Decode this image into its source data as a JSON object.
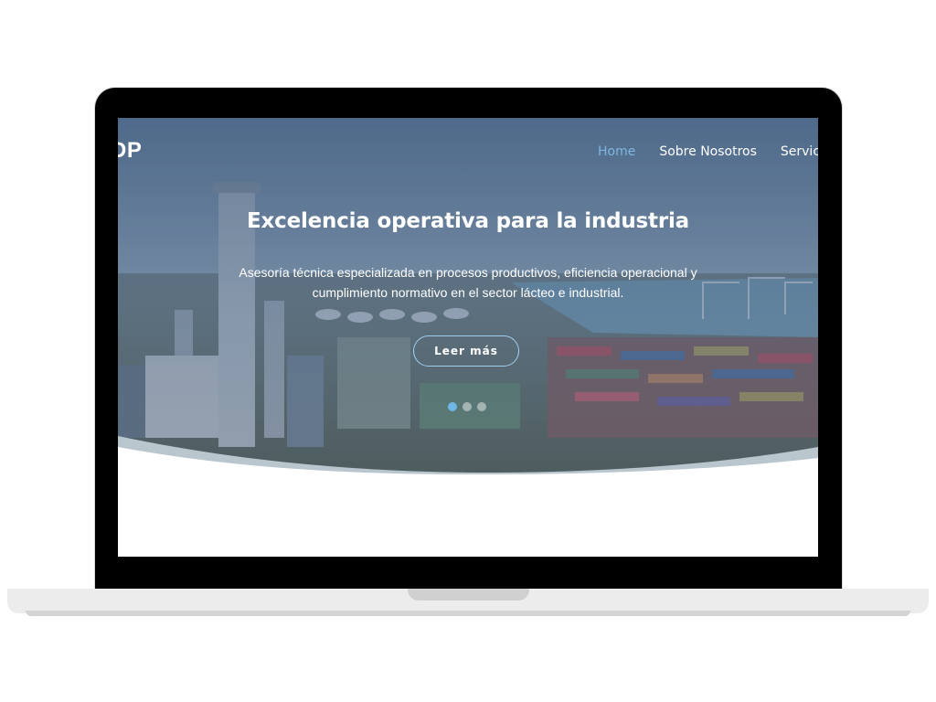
{
  "header": {
    "brand_text": "DP",
    "nav": [
      {
        "label": "Home",
        "active": true
      },
      {
        "label": "Sobre Nosotros",
        "active": false
      },
      {
        "label": "Servicios",
        "active": false
      }
    ]
  },
  "hero": {
    "title": "Excelencia operativa para la industria",
    "description_line1": "Asesoría técnica especializada en procesos productivos, eficiencia operacional y",
    "description_line2": "cumplimiento normativo en el sector lácteo e industrial.",
    "button_label": "Leer más",
    "slides": 3,
    "active_slide": 1
  },
  "colors": {
    "accent": "#6fb7e6",
    "nav_active": "#7fb6dd",
    "wave": "#b9c6ce"
  }
}
